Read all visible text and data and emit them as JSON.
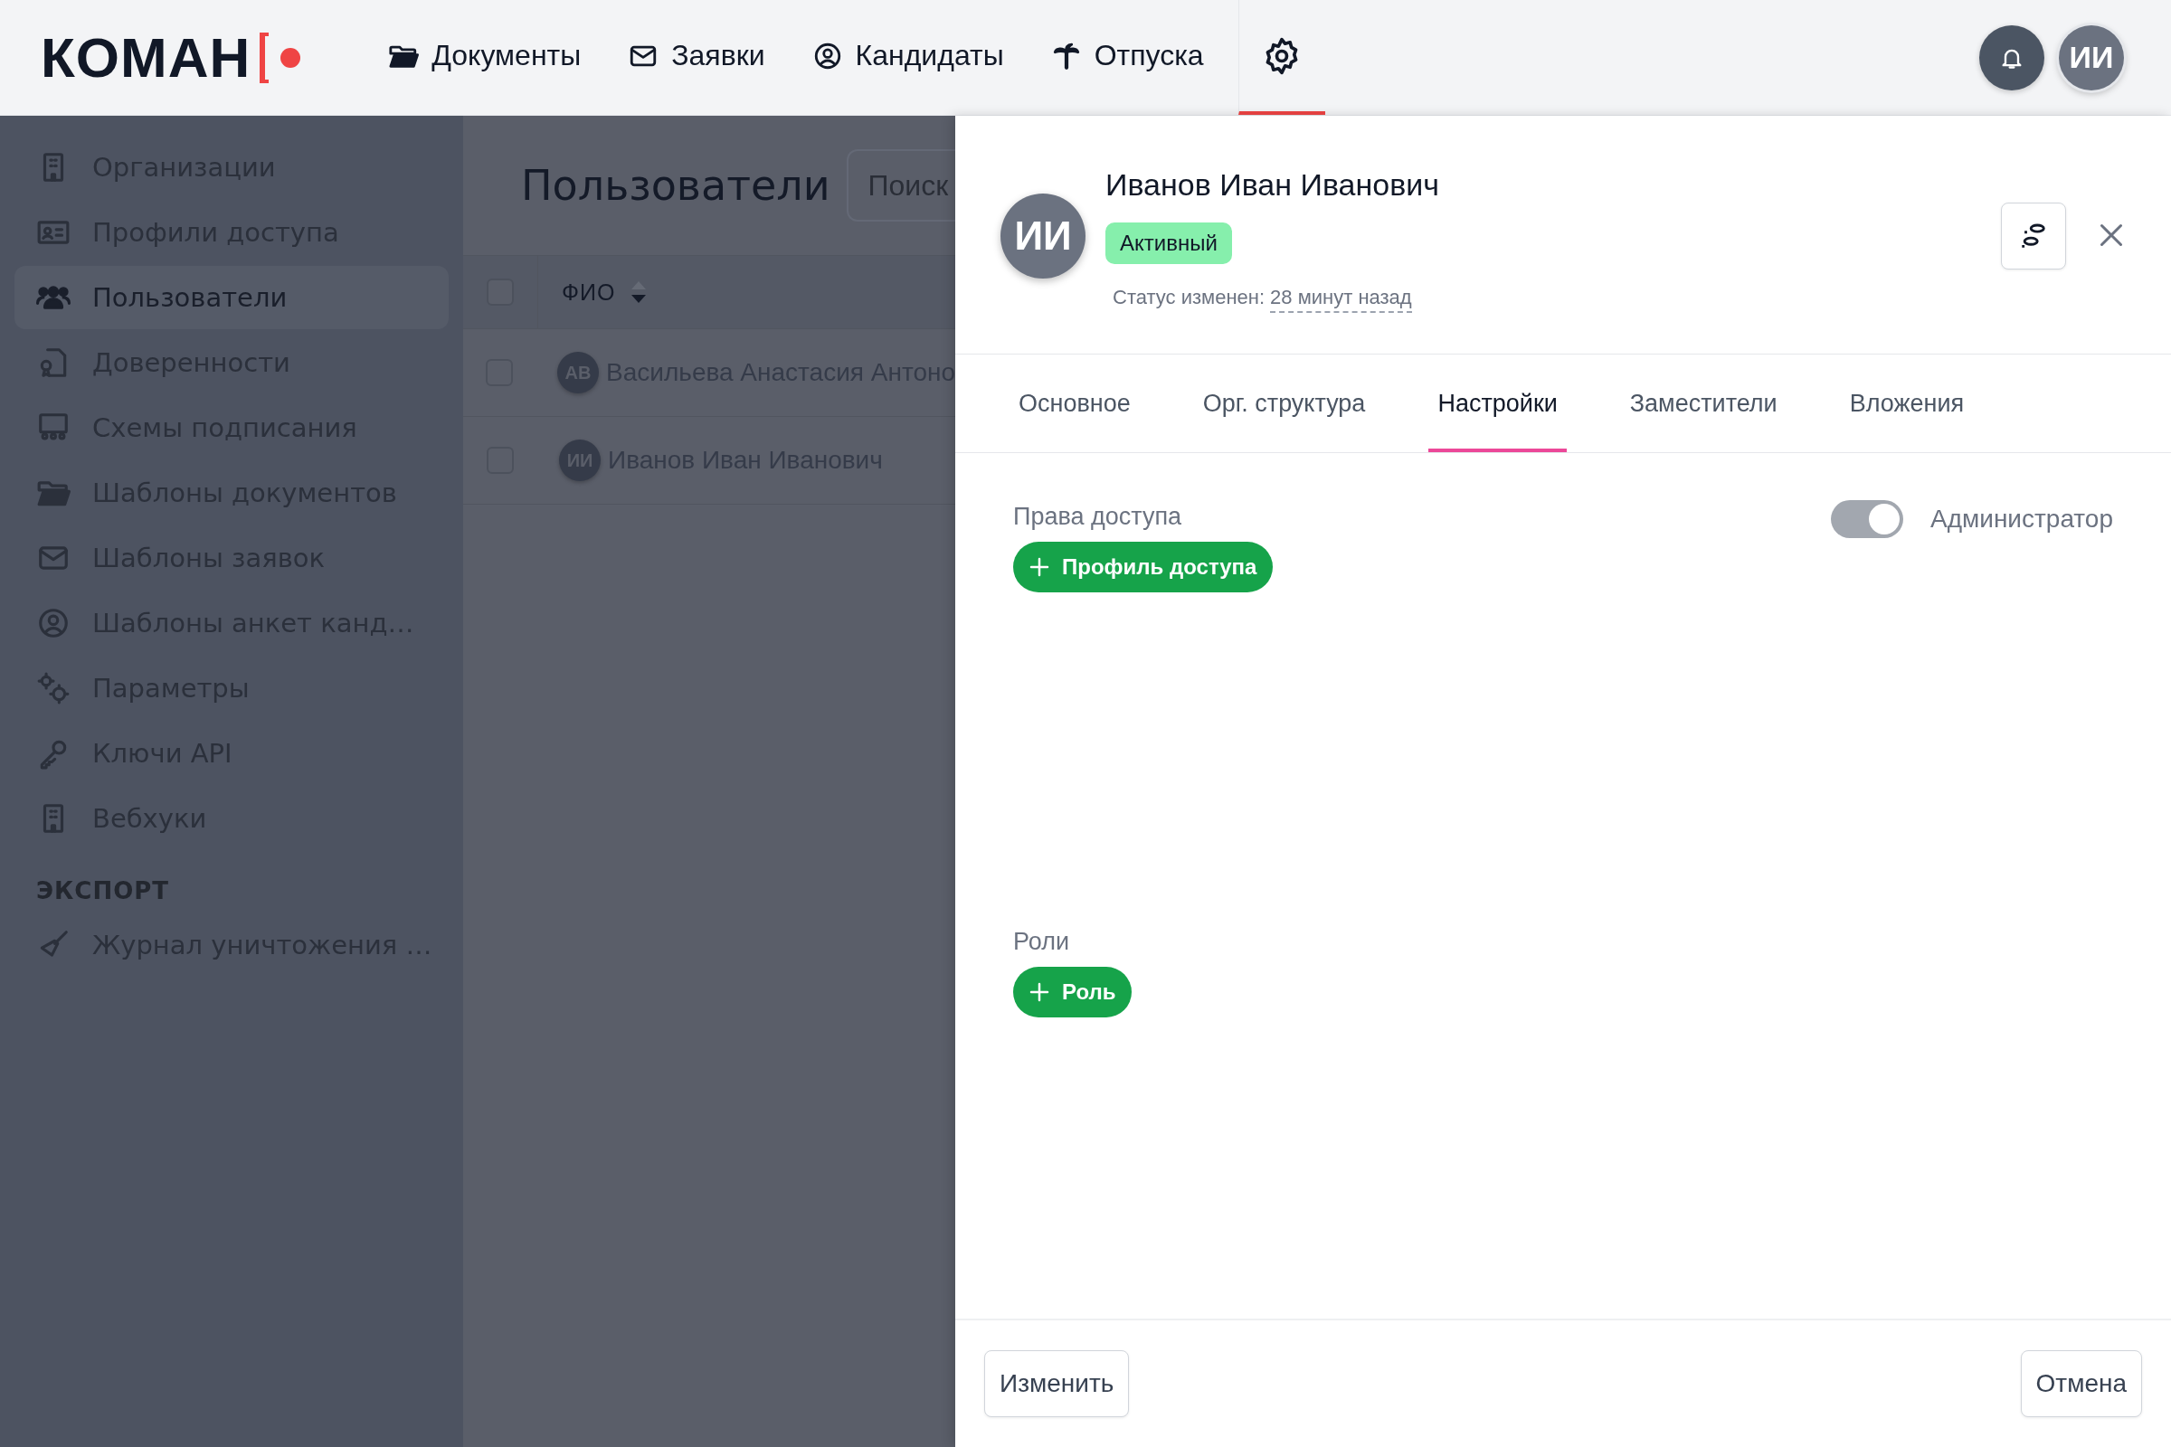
{
  "topbar": {
    "logo": "КОМАН",
    "nav": [
      {
        "label": "Документы",
        "selected": false
      },
      {
        "label": "Заявки",
        "selected": false
      },
      {
        "label": "Кандидаты",
        "selected": false
      },
      {
        "label": "Отпуска",
        "selected": false
      }
    ],
    "settings_tab": {
      "selected": true
    },
    "avatar": "ИИ"
  },
  "sidebar": {
    "items": [
      {
        "label": "Организации",
        "selected": false
      },
      {
        "label": "Профили доступа",
        "selected": false
      },
      {
        "label": "Пользователи",
        "selected": true
      },
      {
        "label": "Доверенности",
        "selected": false
      },
      {
        "label": "Схемы подписания",
        "selected": false
      },
      {
        "label": "Шаблоны документов",
        "selected": false
      },
      {
        "label": "Шаблоны заявок",
        "selected": false
      },
      {
        "label": "Шаблоны анкет канд…",
        "selected": false
      },
      {
        "label": "Параметры",
        "selected": false
      },
      {
        "label": "Ключи API",
        "selected": false
      },
      {
        "label": "Вебхуки",
        "selected": false
      }
    ],
    "section_title": "ЭКСПОРТ",
    "export_items": [
      {
        "label": "Журнал уничтожения …",
        "selected": false
      }
    ]
  },
  "users_page": {
    "title": "Пользователи",
    "search": {
      "placeholder": "Поиск"
    },
    "table": {
      "select_all": {
        "checked": false
      },
      "columns": [
        {
          "label": "ФИО",
          "sort_descending": true
        }
      ],
      "rows": [
        {
          "initials": "АВ",
          "name": "Васильева Анастасия Антоно",
          "checked": false
        },
        {
          "initials": "ИИ",
          "name": "Иванов Иван Иванович",
          "checked": false
        }
      ]
    }
  },
  "drawer": {
    "initials": "ИИ",
    "name": "Иванов Иван Иванович",
    "status": {
      "label": "Активный",
      "kind": "active"
    },
    "status_changed": {
      "label": "Статус изменен:",
      "time": "28 минут назад"
    },
    "tabs": [
      {
        "label": "Основное",
        "selected": false
      },
      {
        "label": "Орг. структура",
        "selected": false
      },
      {
        "label": "Настройки",
        "selected": true
      },
      {
        "label": "Заместители",
        "selected": false
      },
      {
        "label": "Вложения",
        "selected": false
      }
    ],
    "access": {
      "title": "Права доступа",
      "add_button": "Профиль доступа"
    },
    "admin_toggle": {
      "label": "Администратор",
      "on": true,
      "disabled": true
    },
    "roles": {
      "title": "Роли",
      "add_button": "Роль"
    },
    "footer": {
      "edit_button": "Изменить",
      "cancel_button": "Отмена"
    }
  }
}
